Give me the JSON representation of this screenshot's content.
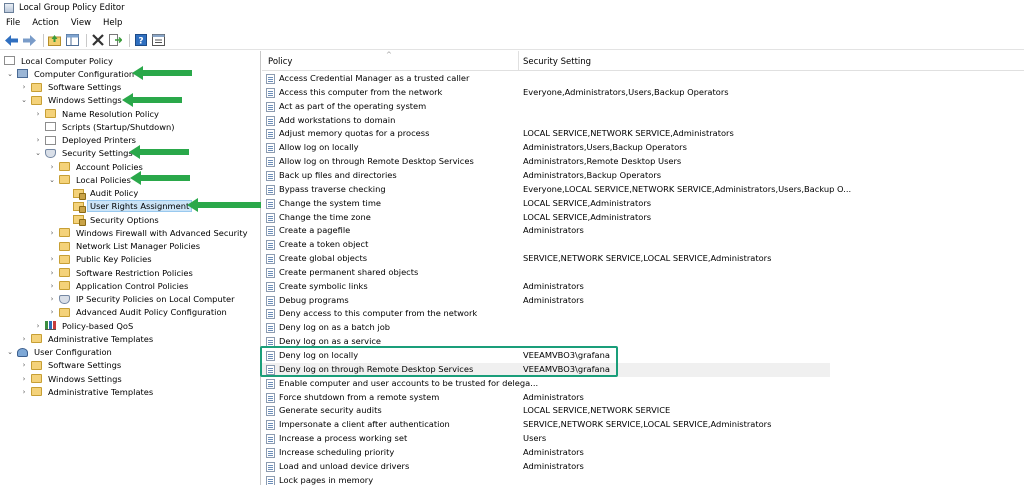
{
  "window": {
    "title": "Local Group Policy Editor"
  },
  "menu": [
    "File",
    "Action",
    "View",
    "Help"
  ],
  "toolbar": [
    {
      "icon": "back-arrow-icon"
    },
    {
      "icon": "forward-arrow-icon"
    },
    {
      "icon": "up-folder-icon"
    },
    {
      "icon": "show-hide-tree-icon"
    },
    {
      "icon": "delete-icon"
    },
    {
      "icon": "export-list-icon"
    },
    {
      "icon": "help-icon"
    },
    {
      "icon": "properties-icon"
    }
  ],
  "tree": [
    {
      "label": "Local Computer Policy",
      "level": 0,
      "icon": "doc",
      "exp": ""
    },
    {
      "label": "Computer Configuration",
      "level": 1,
      "icon": "comp",
      "exp": "v"
    },
    {
      "label": "Software Settings",
      "level": 2,
      "icon": "fold",
      "exp": ">"
    },
    {
      "label": "Windows Settings",
      "level": 2,
      "icon": "fold",
      "exp": "v"
    },
    {
      "label": "Name Resolution Policy",
      "level": 3,
      "icon": "fold",
      "exp": ">"
    },
    {
      "label": "Scripts (Startup/Shutdown)",
      "level": 3,
      "icon": "doc",
      "exp": ""
    },
    {
      "label": "Deployed Printers",
      "level": 3,
      "icon": "doc",
      "exp": ">"
    },
    {
      "label": "Security Settings",
      "level": 3,
      "icon": "shield",
      "exp": "v"
    },
    {
      "label": "Account Policies",
      "level": 4,
      "icon": "fold",
      "exp": ">"
    },
    {
      "label": "Local Policies",
      "level": 4,
      "icon": "fold",
      "exp": "v"
    },
    {
      "label": "Audit Policy",
      "level": 5,
      "icon": "fold-lock",
      "exp": ""
    },
    {
      "label": "User Rights Assignment",
      "level": 5,
      "icon": "fold-lock",
      "exp": "",
      "selected": true
    },
    {
      "label": "Security Options",
      "level": 5,
      "icon": "fold-lock",
      "exp": ""
    },
    {
      "label": "Windows Firewall with Advanced Security",
      "level": 4,
      "icon": "fold",
      "exp": ">"
    },
    {
      "label": "Network List Manager Policies",
      "level": 4,
      "icon": "fold",
      "exp": ""
    },
    {
      "label": "Public Key Policies",
      "level": 4,
      "icon": "fold",
      "exp": ">"
    },
    {
      "label": "Software Restriction Policies",
      "level": 4,
      "icon": "fold",
      "exp": ">"
    },
    {
      "label": "Application Control Policies",
      "level": 4,
      "icon": "fold",
      "exp": ">"
    },
    {
      "label": "IP Security Policies on Local Computer",
      "level": 4,
      "icon": "shield",
      "exp": ">"
    },
    {
      "label": "Advanced Audit Policy Configuration",
      "level": 4,
      "icon": "fold",
      "exp": ">"
    },
    {
      "label": "Policy-based QoS",
      "level": 3,
      "icon": "chart",
      "exp": ">"
    },
    {
      "label": "Administrative Templates",
      "level": 2,
      "icon": "fold",
      "exp": ">"
    },
    {
      "label": "User Configuration",
      "level": 1,
      "icon": "user",
      "exp": "v"
    },
    {
      "label": "Software Settings",
      "level": 2,
      "icon": "fold",
      "exp": ">"
    },
    {
      "label": "Windows Settings",
      "level": 2,
      "icon": "fold",
      "exp": ">"
    },
    {
      "label": "Administrative Templates",
      "level": 2,
      "icon": "fold",
      "exp": ">"
    }
  ],
  "list": {
    "headers": {
      "policy": "Policy",
      "setting": "Security Setting"
    },
    "rows": [
      {
        "policy": "Access Credential Manager as a trusted caller",
        "setting": ""
      },
      {
        "policy": "Access this computer from the network",
        "setting": "Everyone,Administrators,Users,Backup Operators"
      },
      {
        "policy": "Act as part of the operating system",
        "setting": ""
      },
      {
        "policy": "Add workstations to domain",
        "setting": ""
      },
      {
        "policy": "Adjust memory quotas for a process",
        "setting": "LOCAL SERVICE,NETWORK SERVICE,Administrators"
      },
      {
        "policy": "Allow log on locally",
        "setting": "Administrators,Users,Backup Operators"
      },
      {
        "policy": "Allow log on through Remote Desktop Services",
        "setting": "Administrators,Remote Desktop Users"
      },
      {
        "policy": "Back up files and directories",
        "setting": "Administrators,Backup Operators"
      },
      {
        "policy": "Bypass traverse checking",
        "setting": "Everyone,LOCAL SERVICE,NETWORK SERVICE,Administrators,Users,Backup O..."
      },
      {
        "policy": "Change the system time",
        "setting": "LOCAL SERVICE,Administrators"
      },
      {
        "policy": "Change the time zone",
        "setting": "LOCAL SERVICE,Administrators"
      },
      {
        "policy": "Create a pagefile",
        "setting": "Administrators"
      },
      {
        "policy": "Create a token object",
        "setting": ""
      },
      {
        "policy": "Create global objects",
        "setting": "SERVICE,NETWORK SERVICE,LOCAL SERVICE,Administrators"
      },
      {
        "policy": "Create permanent shared objects",
        "setting": ""
      },
      {
        "policy": "Create symbolic links",
        "setting": "Administrators"
      },
      {
        "policy": "Debug programs",
        "setting": "Administrators"
      },
      {
        "policy": "Deny access to this computer from the network",
        "setting": ""
      },
      {
        "policy": "Deny log on as a batch job",
        "setting": ""
      },
      {
        "policy": "Deny log on as a service",
        "setting": ""
      },
      {
        "policy": "Deny log on locally",
        "setting": "VEEAMVBO3\\grafana"
      },
      {
        "policy": "Deny log on through Remote Desktop Services",
        "setting": "VEEAMVBO3\\grafana",
        "hover": true
      },
      {
        "policy": "Enable computer and user accounts to be trusted for delega...",
        "setting": ""
      },
      {
        "policy": "Force shutdown from a remote system",
        "setting": "Administrators"
      },
      {
        "policy": "Generate security audits",
        "setting": "LOCAL SERVICE,NETWORK SERVICE"
      },
      {
        "policy": "Impersonate a client after authentication",
        "setting": "SERVICE,NETWORK SERVICE,LOCAL SERVICE,Administrators"
      },
      {
        "policy": "Increase a process working set",
        "setting": "Users"
      },
      {
        "policy": "Increase scheduling priority",
        "setting": "Administrators"
      },
      {
        "policy": "Load and unload device drivers",
        "setting": "Administrators"
      },
      {
        "policy": "Lock pages in memory",
        "setting": ""
      }
    ]
  },
  "annotation_colors": {
    "arrow": "#2aa84a",
    "highlight_box": "#1a9e7a",
    "selection": "#cce4f7"
  }
}
